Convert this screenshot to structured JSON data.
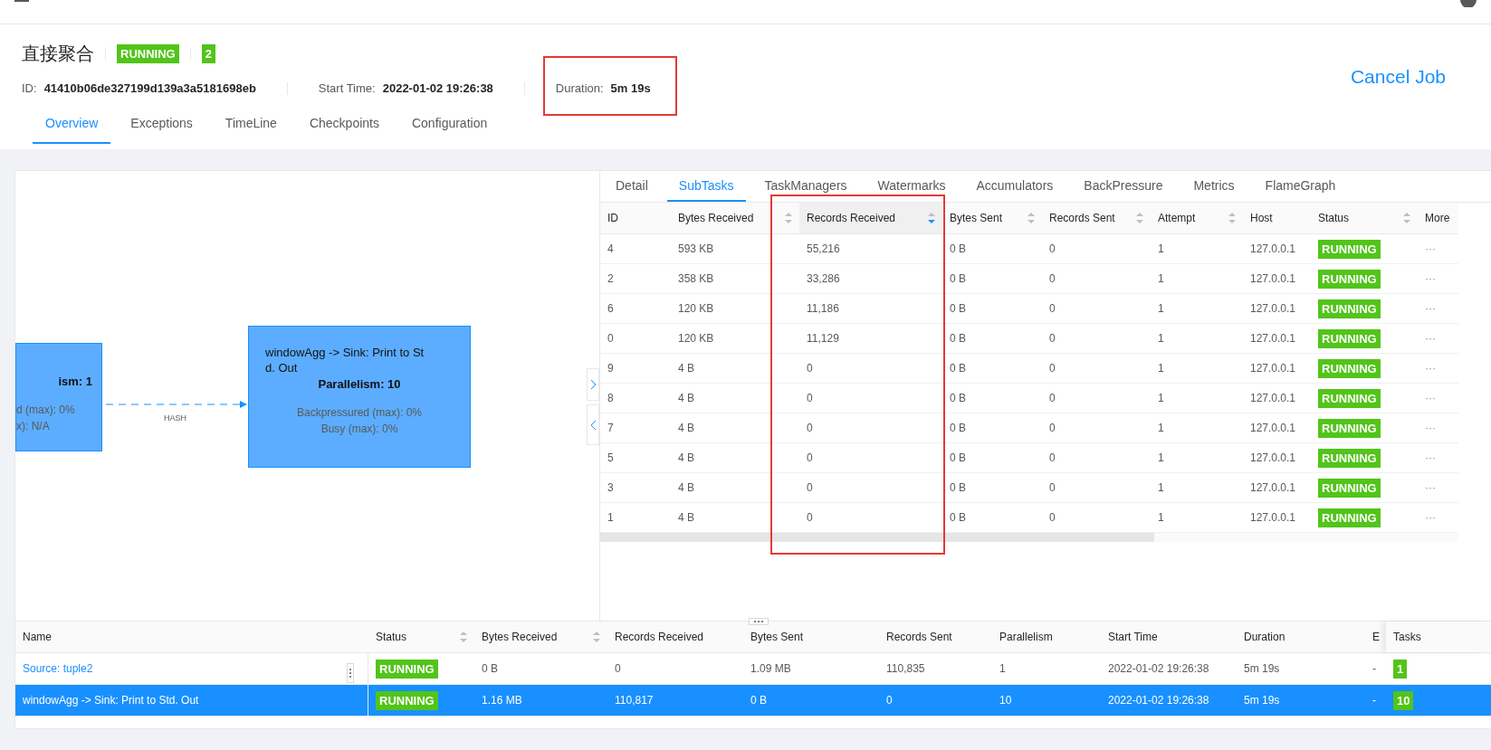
{
  "job": {
    "name": "直接聚合",
    "status": "RUNNING",
    "count": "2",
    "id_label": "ID:",
    "id": "41410b06de327199d139a3a5181698eb",
    "start_label": "Start Time:",
    "start": "2022-01-02 19:26:38",
    "duration_label": "Duration:",
    "duration": "5m 19s",
    "cancel": "Cancel Job"
  },
  "tabs": [
    {
      "label": "Overview",
      "selected": true
    },
    {
      "label": "Exceptions",
      "selected": false
    },
    {
      "label": "TimeLine",
      "selected": false
    },
    {
      "label": "Checkpoints",
      "selected": false
    },
    {
      "label": "Configuration",
      "selected": false
    }
  ],
  "graph": {
    "nodes": [
      {
        "lines": [
          "ism: 1"
        ],
        "stats": [
          "d (max): 0%",
          "x): N/A"
        ]
      },
      {
        "lines": [
          "windowAgg -> Sink: Print to St",
          "d. Out"
        ],
        "parallelism": "Parallelism: 10",
        "stats": [
          "Backpressured (max): 0%",
          "Busy (max): 0%"
        ]
      }
    ],
    "edge_label": "HASH"
  },
  "detail_tabs": [
    {
      "label": "Detail",
      "selected": false
    },
    {
      "label": "SubTasks",
      "selected": true
    },
    {
      "label": "TaskManagers",
      "selected": false
    },
    {
      "label": "Watermarks",
      "selected": false
    },
    {
      "label": "Accumulators",
      "selected": false
    },
    {
      "label": "BackPressure",
      "selected": false
    },
    {
      "label": "Metrics",
      "selected": false
    },
    {
      "label": "FlameGraph",
      "selected": false
    }
  ],
  "subtasks": {
    "columns": [
      {
        "label": "ID",
        "sortable": false,
        "sorted": false
      },
      {
        "label": "Bytes Received",
        "sortable": true,
        "sorted": false
      },
      {
        "label": "Records Received",
        "sortable": true,
        "sorted": true
      },
      {
        "label": "Bytes Sent",
        "sortable": true,
        "sorted": false
      },
      {
        "label": "Records Sent",
        "sortable": true,
        "sorted": false
      },
      {
        "label": "Attempt",
        "sortable": true,
        "sorted": false
      },
      {
        "label": "Host",
        "sortable": false,
        "sorted": false
      },
      {
        "label": "Status",
        "sortable": true,
        "sorted": false
      },
      {
        "label": "More",
        "sortable": false,
        "sorted": false
      }
    ],
    "rows": [
      [
        "4",
        "593 KB",
        "55,216",
        "0 B",
        "0",
        "1",
        "127.0.0.1",
        "RUNNING",
        "···"
      ],
      [
        "2",
        "358 KB",
        "33,286",
        "0 B",
        "0",
        "1",
        "127.0.0.1",
        "RUNNING",
        "···"
      ],
      [
        "6",
        "120 KB",
        "11,186",
        "0 B",
        "0",
        "1",
        "127.0.0.1",
        "RUNNING",
        "···"
      ],
      [
        "0",
        "120 KB",
        "11,129",
        "0 B",
        "0",
        "1",
        "127.0.0.1",
        "RUNNING",
        "···"
      ],
      [
        "9",
        "4 B",
        "0",
        "0 B",
        "0",
        "1",
        "127.0.0.1",
        "RUNNING",
        "···"
      ],
      [
        "8",
        "4 B",
        "0",
        "0 B",
        "0",
        "1",
        "127.0.0.1",
        "RUNNING",
        "···"
      ],
      [
        "7",
        "4 B",
        "0",
        "0 B",
        "0",
        "1",
        "127.0.0.1",
        "RUNNING",
        "···"
      ],
      [
        "5",
        "4 B",
        "0",
        "0 B",
        "0",
        "1",
        "127.0.0.1",
        "RUNNING",
        "···"
      ],
      [
        "3",
        "4 B",
        "0",
        "0 B",
        "0",
        "1",
        "127.0.0.1",
        "RUNNING",
        "···"
      ],
      [
        "1",
        "4 B",
        "0",
        "0 B",
        "0",
        "1",
        "127.0.0.1",
        "RUNNING",
        "···"
      ]
    ]
  },
  "vertices": {
    "columns": [
      {
        "label": "Name",
        "sortable": false
      },
      {
        "label": "Status",
        "sortable": true
      },
      {
        "label": "Bytes Received",
        "sortable": true
      },
      {
        "label": "Records Received",
        "sortable": false
      },
      {
        "label": "Bytes Sent",
        "sortable": false
      },
      {
        "label": "Records Sent",
        "sortable": false
      },
      {
        "label": "Parallelism",
        "sortable": false
      },
      {
        "label": "Start Time",
        "sortable": false
      },
      {
        "label": "Duration",
        "sortable": false
      },
      {
        "label": "E",
        "sortable": false
      },
      {
        "label": "Tasks",
        "sortable": false
      }
    ],
    "rows": [
      {
        "selected": false,
        "cells": [
          "Source: tuple2",
          "RUNNING",
          "0 B",
          "0",
          "1.09 MB",
          "110,835",
          "1",
          "2022-01-02 19:26:38",
          "5m 19s",
          "-",
          "1"
        ]
      },
      {
        "selected": true,
        "cells": [
          "windowAgg -> Sink: Print to Std. Out",
          "RUNNING",
          "1.16 MB",
          "110,817",
          "0 B",
          "0",
          "10",
          "2022-01-02 19:26:38",
          "5m 19s",
          "-",
          "10"
        ]
      }
    ]
  }
}
